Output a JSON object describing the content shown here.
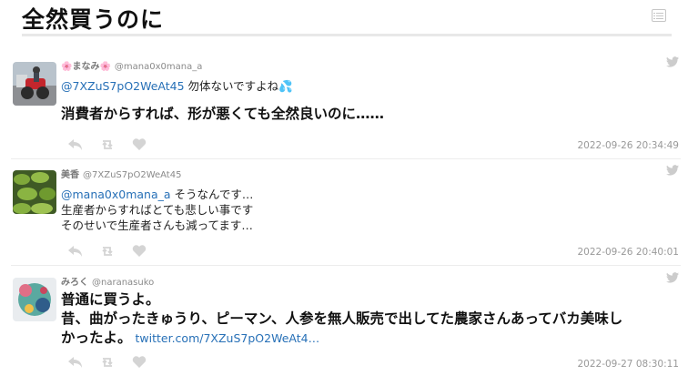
{
  "page": {
    "title": "全然買うのに"
  },
  "tweets": [
    {
      "display_name": "🌸まなみ🌸",
      "handle": "@mana0x0mana_a",
      "line1_mention": "@7XZuS7pO2WeAt45",
      "line1_text": " 勿体ないですよね💦",
      "line2": "消費者からすれば、形が悪くても全然良いのに……",
      "timestamp": "2022-09-26 20:34:49"
    },
    {
      "display_name": "美香",
      "handle": "@7XZuS7pO2WeAt45",
      "line1_mention": "@mana0x0mana_a",
      "line1_text": " そうなんです…",
      "line2": "生産者からすればとても悲しい事です",
      "line3": "そのせいで生産者さんも減ってます…",
      "timestamp": "2022-09-26 20:40:01"
    },
    {
      "display_name": "みろく",
      "handle": "@naranasuko",
      "line1": "普通に買うよ。",
      "line2": "昔、曲がったきゅうり、ピーマン、人参を無人販売で出してた農家さんあってバカ美味し",
      "line3": "かったよ。",
      "link": "twitter.com/7XZuS7pO2WeAt4…",
      "timestamp": "2022-09-27 08:30:11"
    }
  ],
  "colors": {
    "link": "#2770b7",
    "muted": "#999999",
    "icon": "#c6c6c6"
  },
  "icons": [
    "list-icon",
    "twitter-bird-icon",
    "reply-icon",
    "retweet-icon",
    "like-heart-icon"
  ]
}
